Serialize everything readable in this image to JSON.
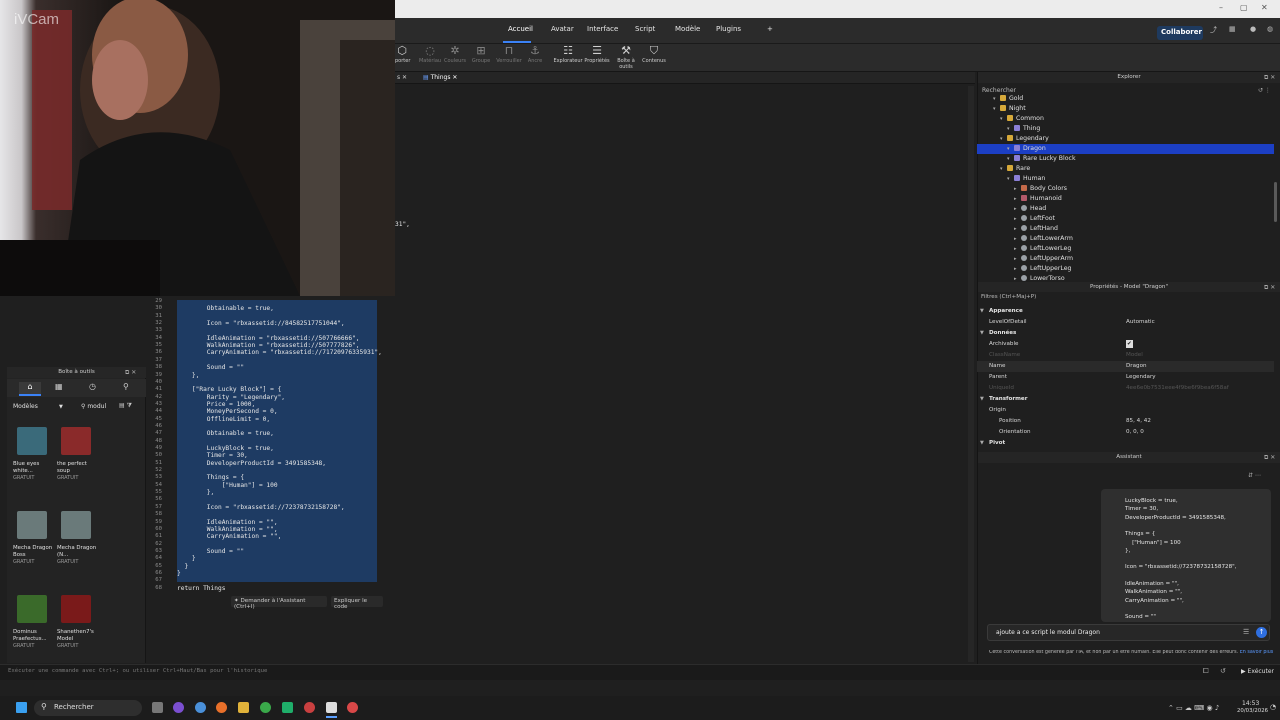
{
  "window": {
    "controls": [
      "–",
      "▢",
      "✕"
    ]
  },
  "menu": {
    "tabs": [
      "Accueil",
      "Avatar",
      "Interface",
      "Script",
      "Modèle",
      "Plugins",
      "+"
    ],
    "active": "Accueil",
    "collaborate": "Collaborer"
  },
  "ribbon": {
    "buttons": [
      {
        "label": "porter",
        "icon": "import-icon"
      },
      {
        "label": "Matériau",
        "icon": "material-icon"
      },
      {
        "label": "Couleurs",
        "icon": "color-icon"
      },
      {
        "label": "Groupe",
        "icon": "group-icon"
      },
      {
        "label": "Verrouiller",
        "icon": "lock-icon"
      },
      {
        "label": "Ancre",
        "icon": "anchor-icon"
      },
      {
        "label": "Explorateur",
        "icon": "explorer-icon"
      },
      {
        "label": "Propriétés",
        "icon": "properties-icon"
      },
      {
        "label": "Boîte à outils",
        "icon": "toolbox-icon"
      },
      {
        "label": "Contenus",
        "icon": "contents-icon"
      }
    ]
  },
  "editor_tab": {
    "name": "Things"
  },
  "code": {
    "line_numbers": [
      "29",
      "30",
      "31",
      "32",
      "33",
      "34",
      "35",
      "36",
      "37",
      "38",
      "39",
      "40",
      "41",
      "42",
      "43",
      "44",
      "45",
      "46",
      "47",
      "48",
      "49",
      "50",
      "51",
      "52",
      "53",
      "54",
      "55",
      "56",
      "57",
      "58",
      "59",
      "60",
      "61",
      "62",
      "63",
      "64",
      "65",
      "66",
      "67",
      "68"
    ],
    "lines": [
      "",
      "        Obtainable = true,",
      "",
      "        Icon = \"rbxassetid://84582517751044\",",
      "",
      "        IdleAnimation = \"rbxassetid://507766666\",",
      "        WalkAnimation = \"rbxassetid://507777826\",",
      "        CarryAnimation = \"rbxassetid://71720976335931\",",
      "",
      "        Sound = \"\"",
      "    },",
      "",
      "    [\"Rare Lucky Block\"] = {",
      "        Rarity = \"Legendary\",",
      "        Price = 1000,",
      "        MoneyPerSecond = 0,",
      "        OfflineLimit = 0,",
      "",
      "        Obtainable = true,",
      "",
      "        LuckyBlock = true,",
      "        Timer = 30,",
      "        DeveloperProductId = 3491585348,",
      "",
      "        Things = {",
      "            [\"Human\"] = 100",
      "        },",
      "",
      "        Icon = \"rbxassetid://72378732158728\",",
      "",
      "        IdleAnimation = \"\",",
      "        WalkAnimation = \"\",",
      "        CarryAnimation = \"\",",
      "",
      "        Sound = \"\"",
      "    }",
      "  }",
      "}",
      "",
      "return Things"
    ],
    "fragment_top": "31\",",
    "fragment_top2": "31\","
  },
  "ai_hint": {
    "ask": "Demander à l'Assistant (Ctrl+I)",
    "explain": "Expliquer le code"
  },
  "webcam": {
    "watermark": "iVCam"
  },
  "toolbox": {
    "title": "Boîte à outils",
    "category": "Modèles",
    "search_value": "modul",
    "items": [
      {
        "name": "Blue eyes white...",
        "price": "GRATUIT",
        "color": "#3a6a7a"
      },
      {
        "name": "the perfect soup",
        "price": "GRATUIT",
        "color": "#8a2a2a"
      },
      {
        "name": "Mecha Dragon Boss",
        "price": "GRATUIT",
        "color": "#6a7a7a"
      },
      {
        "name": "Mecha Dragon (N...",
        "price": "GRATUIT",
        "color": "#6a7a7a"
      },
      {
        "name": "Dominus Praefectus...",
        "price": "GRATUIT",
        "color": "#3a6a2a"
      },
      {
        "name": "Shanethen7's Model",
        "price": "GRATUIT",
        "color": "#7a1a1a"
      }
    ]
  },
  "explorer": {
    "title": "Explorer",
    "search": "Rechercher",
    "rows": [
      {
        "label": "Gold",
        "type": "folder",
        "depth": 2
      },
      {
        "label": "Night",
        "type": "folder",
        "depth": 2
      },
      {
        "label": "Common",
        "type": "folder",
        "depth": 3
      },
      {
        "label": "Thing",
        "type": "model",
        "depth": 4
      },
      {
        "label": "Legendary",
        "type": "folder",
        "depth": 3
      },
      {
        "label": "Dragon",
        "type": "model",
        "depth": 4,
        "selected": true
      },
      {
        "label": "Rare Lucky Block",
        "type": "model",
        "depth": 4
      },
      {
        "label": "Rare",
        "type": "folder",
        "depth": 3
      },
      {
        "label": "Human",
        "type": "model",
        "depth": 4
      },
      {
        "label": "Body Colors",
        "type": "bc",
        "depth": 5
      },
      {
        "label": "Humanoid",
        "type": "hum",
        "depth": 5
      },
      {
        "label": "Head",
        "type": "part",
        "depth": 5
      },
      {
        "label": "LeftFoot",
        "type": "part",
        "depth": 5
      },
      {
        "label": "LeftHand",
        "type": "part",
        "depth": 5
      },
      {
        "label": "LeftLowerArm",
        "type": "part",
        "depth": 5
      },
      {
        "label": "LeftLowerLeg",
        "type": "part",
        "depth": 5
      },
      {
        "label": "LeftUpperArm",
        "type": "part",
        "depth": 5
      },
      {
        "label": "LeftUpperLeg",
        "type": "part",
        "depth": 5
      },
      {
        "label": "LowerTorso",
        "type": "part",
        "depth": 5
      }
    ]
  },
  "properties": {
    "title": "Propriétés - Model \"Dragon\"",
    "filter": "Filtres (Ctrl+Maj+P)",
    "rows": [
      {
        "k": "Apparence",
        "section": true
      },
      {
        "k": "LevelOfDetail",
        "v": "Automatic"
      },
      {
        "k": "Données",
        "section": true
      },
      {
        "k": "Archivable",
        "v": "✔"
      },
      {
        "k": "ClassName",
        "v": "Model",
        "dim": true
      },
      {
        "k": "Name",
        "v": "Dragon"
      },
      {
        "k": "Parent",
        "v": "Legendary"
      },
      {
        "k": "UniqueId",
        "v": "4ee6e0b7531eee4f9be6f9bea6f58af",
        "dim": true
      },
      {
        "k": "Transformer",
        "section": true
      },
      {
        "k": "Origin",
        "v": ""
      },
      {
        "k": "Position",
        "v": "85, 4, 42"
      },
      {
        "k": "Orientation",
        "v": "0, 0, 0"
      },
      {
        "k": "Pivot",
        "section": true
      }
    ]
  },
  "assistant": {
    "title": "Assistant",
    "bubble_lines": [
      "LuckyBlock = true,",
      "Timer = 30,",
      "DeveloperProductId = 3491585348,",
      "",
      "Things = {",
      "    [\"Human\"] = 100",
      "},",
      "",
      "Icon = \"rbxassetid://72378732158728\",",
      "",
      "IdleAnimation = \"\",",
      "WalkAnimation = \"\",",
      "CarryAnimation = \"\",",
      "",
      "Sound = \"\""
    ],
    "input_value": "ajoute a ce script le modul Dragon",
    "disclaimer": "Cette conversation est générée par l'IA, et non par un être humain. Elle peut donc contenir des erreurs.",
    "learn_more": "En savoir plus"
  },
  "command_bar": {
    "placeholder": "Exécuter une commande avec Ctrl+; ou utiliser Ctrl+Haut/Bas pour l'historique",
    "run": "Exécuter"
  },
  "taskbar": {
    "search": "Rechercher",
    "time": "14:53",
    "date": "20/03/2026"
  }
}
